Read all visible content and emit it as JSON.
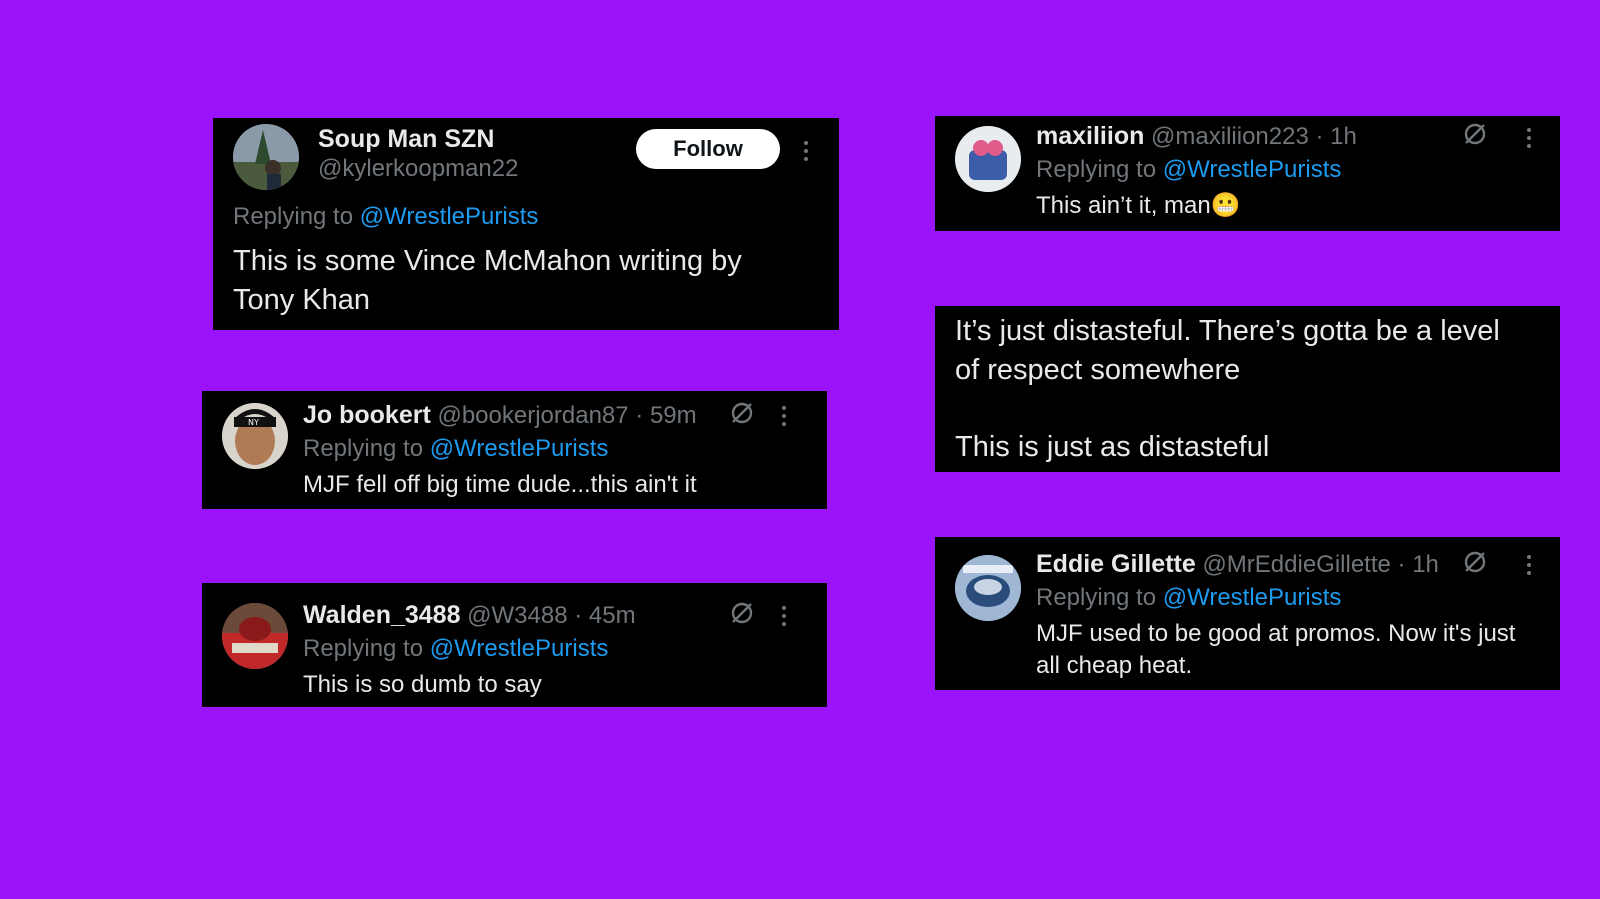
{
  "colors": {
    "background": "#9b13fb",
    "card": "#000000",
    "link": "#1d9bf0",
    "secondary_text": "#71767b",
    "primary_text": "#e7e9ea"
  },
  "tweets": [
    {
      "display_name": "Soup Man SZN",
      "handle": "@kylerkoopman22",
      "follow_label": "Follow",
      "replying_prefix": "Replying to",
      "replying_to": "@WrestlePurists",
      "text_line1": "This is some Vince McMahon writing by",
      "text_line2": "Tony Khan"
    },
    {
      "display_name": "Jo bookert",
      "handle": "@bookerjordan87",
      "time": "· 59m",
      "replying_prefix": "Replying to",
      "replying_to": "@WrestlePurists",
      "text": "MJF fell off big time dude...this ain't it"
    },
    {
      "display_name": "Walden_3488",
      "handle": "@W3488",
      "time": "· 45m",
      "replying_prefix": "Replying to",
      "replying_to": "@WrestlePurists",
      "text": "This is so dumb to say"
    },
    {
      "display_name": "maxiliion",
      "handle": "@maxiliion223",
      "time": "· 1h",
      "replying_prefix": "Replying to",
      "replying_to": "@WrestlePurists",
      "text": "This ain’t it, man",
      "emoji": "😬"
    },
    {
      "text_line1": "It’s just distasteful. There’s gotta be a level",
      "text_line2": "of respect somewhere",
      "text_line3": "This is just as distasteful"
    },
    {
      "display_name": "Eddie Gillette",
      "handle": "@MrEddieGillette",
      "time": "· 1h",
      "replying_prefix": "Replying to",
      "replying_to": "@WrestlePurists",
      "text_line1": "MJF used to be good at promos. Now it's just",
      "text_line2": "all cheap heat."
    }
  ],
  "icons": {
    "grok": "grok-icon",
    "more": "more-options-icon",
    "avatar": "avatar"
  }
}
